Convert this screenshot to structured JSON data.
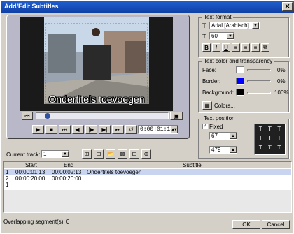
{
  "window": {
    "title": "Add/Edit Subtitles",
    "close_glyph": "✕"
  },
  "preview": {
    "subtitle_text": "Ondertitels toevoegen",
    "timecode": "0:00:01:13"
  },
  "text_format": {
    "group_label": "Text format",
    "font_value": "Arial [Arabisch]",
    "size_value": "60",
    "style_buttons": [
      "B",
      "I",
      "U"
    ]
  },
  "color": {
    "group_label": "Text color and transparency",
    "face_label": "Face:",
    "face_value": "0%",
    "face_color": "#ffffff",
    "border_label": "Border:",
    "border_value": "0%",
    "border_color": "#0000ff",
    "background_label": "Background:",
    "background_value": "100%",
    "background_color": "#000000",
    "colors_button": "Colors..."
  },
  "position": {
    "group_label": "Text position",
    "fixed_label": "Fixed",
    "x_value": "67",
    "y_value": "479"
  },
  "track": {
    "label": "Current track:",
    "value": "1"
  },
  "table": {
    "headers": [
      "",
      "Start",
      "End",
      "Subtitle"
    ],
    "rows": [
      [
        "1",
        "00:00:01:13",
        "00:00:02:13",
        "Ondertitels toevoegen"
      ],
      [
        "2",
        "00:00:20:00",
        "00:00:20:00",
        ""
      ],
      [
        "1",
        "",
        "",
        ""
      ]
    ]
  },
  "status": {
    "overlap": "Overlapping segment(s): 0"
  },
  "buttons": {
    "ok": "OK",
    "cancel": "Cancel"
  }
}
